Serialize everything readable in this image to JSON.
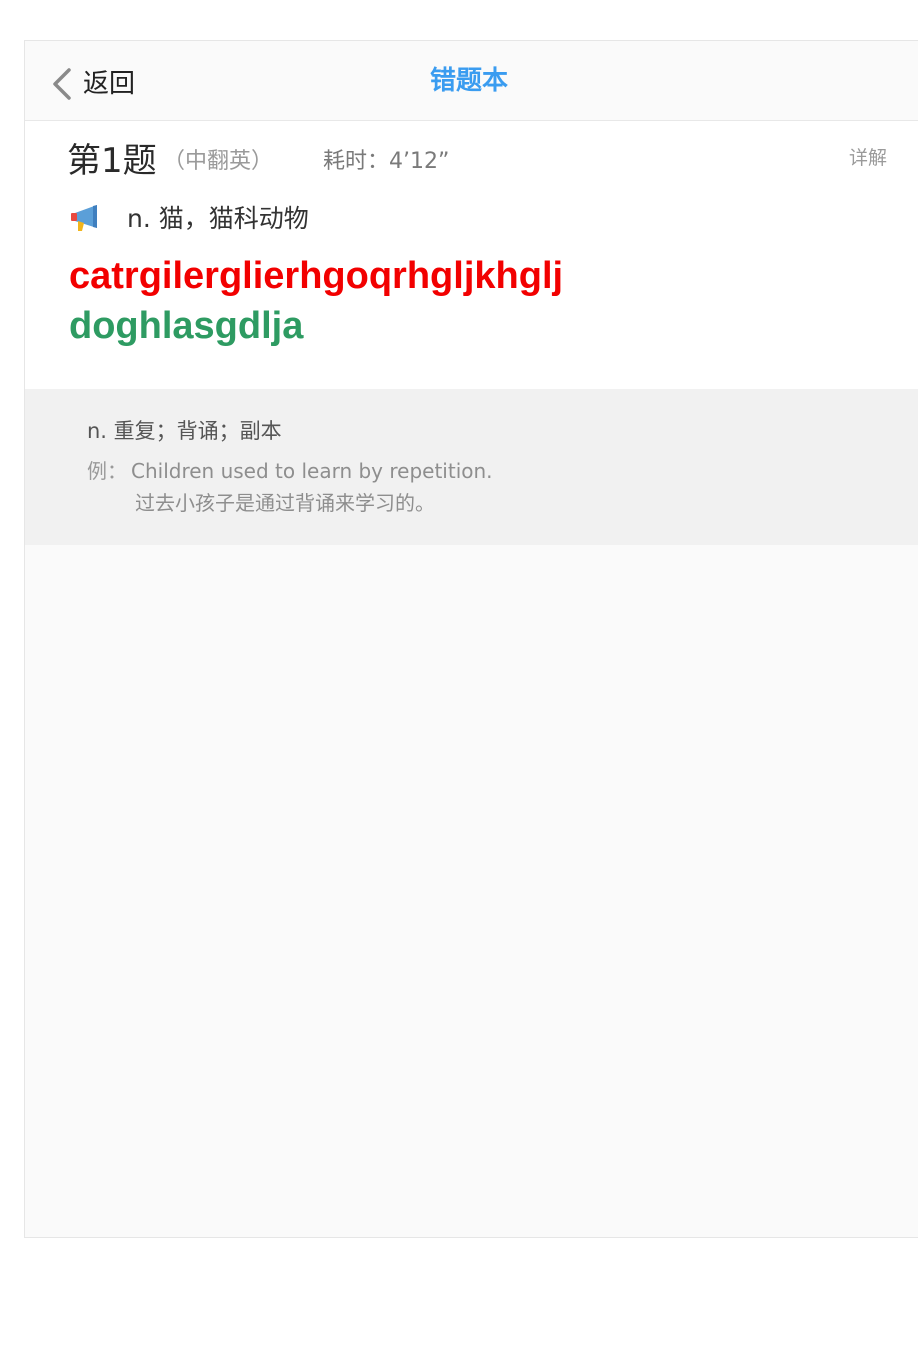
{
  "nav": {
    "back_label": "返回",
    "title": "错题本"
  },
  "question": {
    "number": "第1题",
    "type": "（中翻英）",
    "time": "耗时：4’12”",
    "detail_label": "详解",
    "meaning": "n. 猫，猫科动物",
    "wrong_answer": "catrgilerglierhgoqrhgljkhglj",
    "correct_answer": "doghlasgdlja",
    "icon": "speaker-icon"
  },
  "explanation": {
    "definition": "n. 重复；背诵；副本",
    "example_label": "例：",
    "example_en": "Children used to learn by repetition.",
    "example_zh": "过去小孩子是通过背诵来学习的。"
  },
  "colors": {
    "accent": "#3a9cf0",
    "wrong": "#f20000",
    "correct": "#2e9b62",
    "panel": "#f1f1f1"
  }
}
